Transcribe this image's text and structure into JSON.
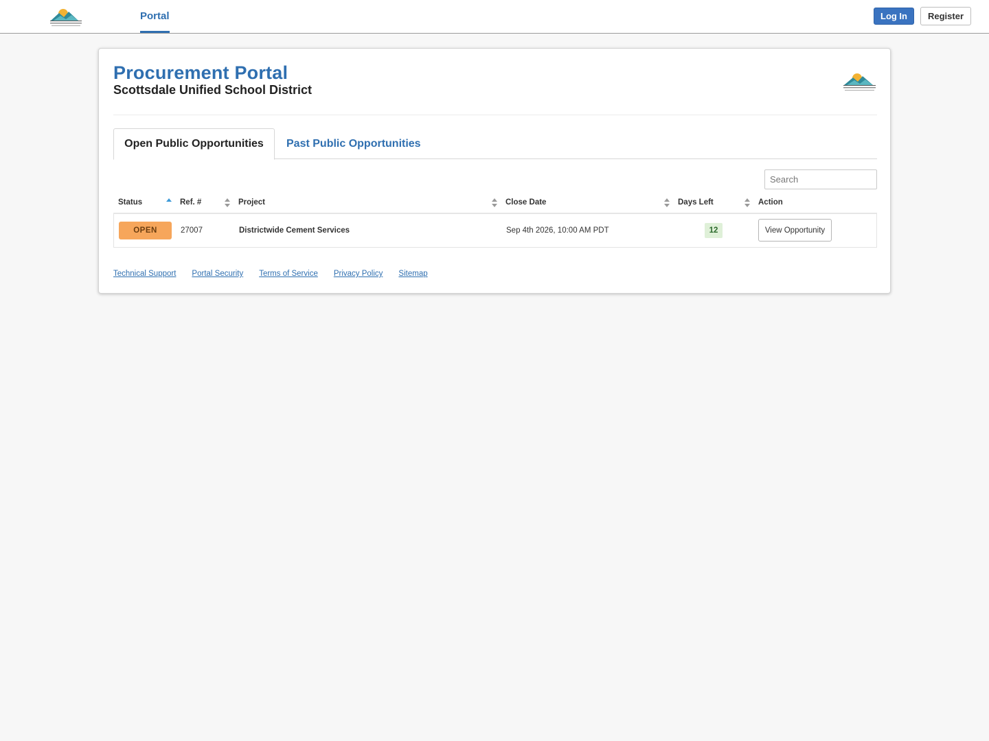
{
  "nav": {
    "logo_icon": "scottsdale-usd-logo",
    "portal_link": "Portal",
    "login_label": "Log In",
    "register_label": "Register"
  },
  "header": {
    "title": "Procurement Portal",
    "subtitle": "Scottsdale Unified School District",
    "logo_icon": "scottsdale-usd-logo"
  },
  "tabs": [
    {
      "label": "Open Public Opportunities",
      "active": true
    },
    {
      "label": "Past Public Opportunities",
      "active": false
    }
  ],
  "search": {
    "placeholder": "Search",
    "value": ""
  },
  "table": {
    "columns": [
      "Status",
      "Ref. #",
      "Project",
      "Close Date",
      "Days Left",
      "Action"
    ],
    "sorted_column": "Status",
    "sort_direction": "ascending",
    "rows": [
      {
        "status": "OPEN",
        "ref": "27007",
        "project": "Districtwide Cement Services",
        "close_date": "Sep 4th 2026, 10:00 AM PDT",
        "days_left": "12",
        "action": "View Opportunity"
      }
    ]
  },
  "footer_links": [
    "Technical Support",
    "Portal Security",
    "Terms of Service",
    "Privacy Policy",
    "Sitemap"
  ],
  "colors": {
    "accent": "#2f6fb0",
    "login_button": "#3a73c0",
    "status_open": "#f6a65b",
    "days_left_bg": "#dff0d8",
    "page_bg": "#f7f7f7"
  }
}
